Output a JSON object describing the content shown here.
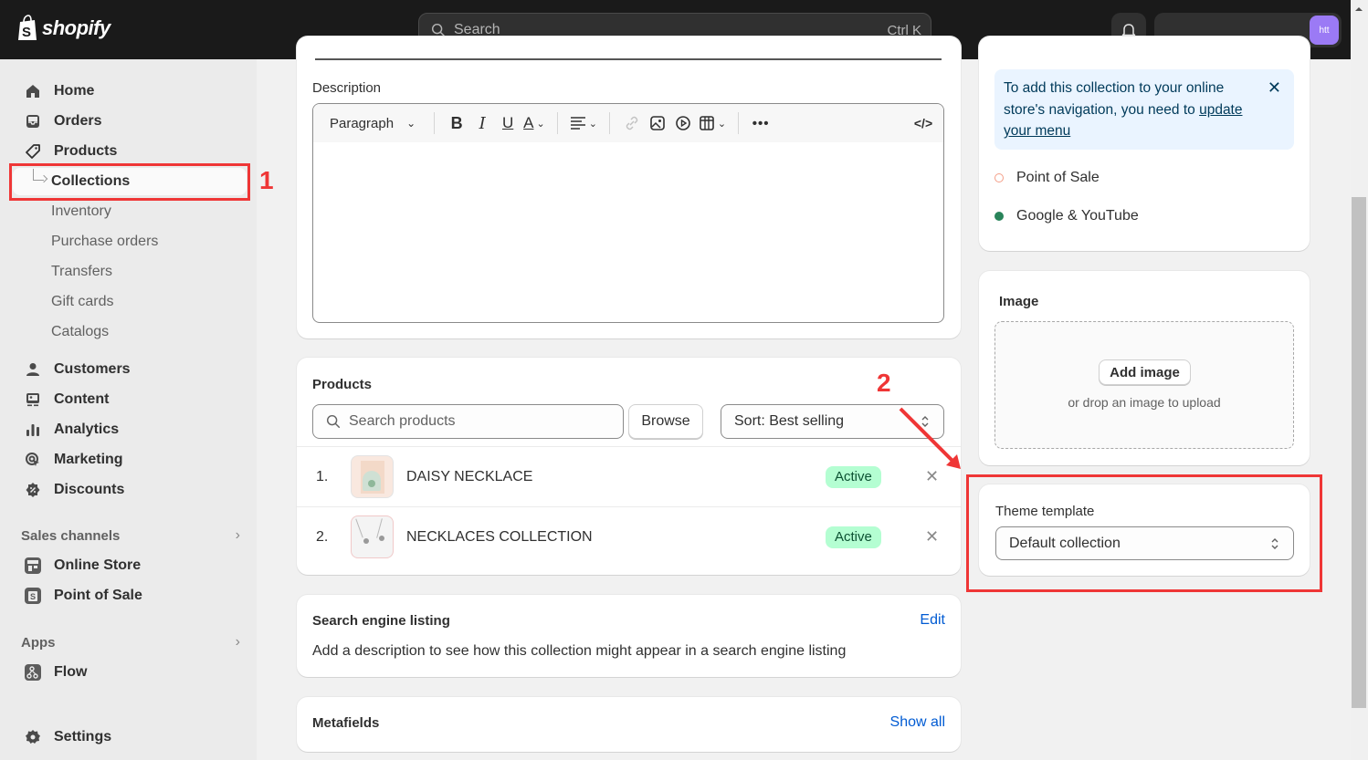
{
  "topbar": {
    "logo_text": "shopify",
    "search_placeholder": "Search",
    "search_shortcut": "Ctrl K",
    "avatar_initials": "htt",
    "avatar_color": "#9b7af5"
  },
  "sidebar": {
    "items": [
      {
        "label": "Home",
        "icon": "home-icon"
      },
      {
        "label": "Orders",
        "icon": "inbox-icon"
      },
      {
        "label": "Products",
        "icon": "tag-icon"
      },
      {
        "label": "Collections",
        "active": true
      },
      {
        "label": "Inventory"
      },
      {
        "label": "Purchase orders"
      },
      {
        "label": "Transfers"
      },
      {
        "label": "Gift cards"
      },
      {
        "label": "Catalogs"
      },
      {
        "label": "Customers",
        "icon": "person-icon"
      },
      {
        "label": "Content",
        "icon": "content-icon"
      },
      {
        "label": "Analytics",
        "icon": "bar-chart-icon"
      },
      {
        "label": "Marketing",
        "icon": "target-icon"
      },
      {
        "label": "Discounts",
        "icon": "discount-icon"
      }
    ],
    "sales_channels": {
      "header": "Sales channels",
      "items": [
        {
          "label": "Online Store",
          "icon": "store-icon"
        },
        {
          "label": "Point of Sale",
          "icon": "pos-icon"
        }
      ]
    },
    "apps": {
      "header": "Apps",
      "items": [
        {
          "label": "Flow",
          "icon": "flow-icon"
        }
      ]
    },
    "settings_label": "Settings"
  },
  "annotations": {
    "one": "1",
    "two": "2",
    "color": "#ef3636"
  },
  "description": {
    "label": "Description",
    "toolbar": {
      "format_select": "Paragraph"
    }
  },
  "products": {
    "title": "Products",
    "search_placeholder": "Search products",
    "browse_label": "Browse",
    "sort_label": "Sort: Best selling",
    "rows": [
      {
        "index": "1.",
        "name": "DAISY NECKLACE",
        "status": "Active"
      },
      {
        "index": "2.",
        "name": "NECKLACES COLLECTION",
        "status": "Active"
      }
    ]
  },
  "seo": {
    "title": "Search engine listing",
    "edit_label": "Edit",
    "description": "Add a description to see how this collection might appear in a search engine listing"
  },
  "metafields": {
    "title": "Metafields",
    "show_all_label": "Show all"
  },
  "availability": {
    "banner_text": "To add this collection to your online store's navigation, you need to",
    "banner_link": "update your menu",
    "channels": [
      {
        "label": "Point of Sale",
        "status": "unpublished"
      },
      {
        "label": "Google & YouTube",
        "status": "published"
      }
    ],
    "published_color": "#29845a",
    "unpublished_color": "#f49e87"
  },
  "image": {
    "title": "Image",
    "add_label": "Add image",
    "hint": "or drop an image to upload"
  },
  "theme_template": {
    "label": "Theme template",
    "value": "Default collection"
  }
}
